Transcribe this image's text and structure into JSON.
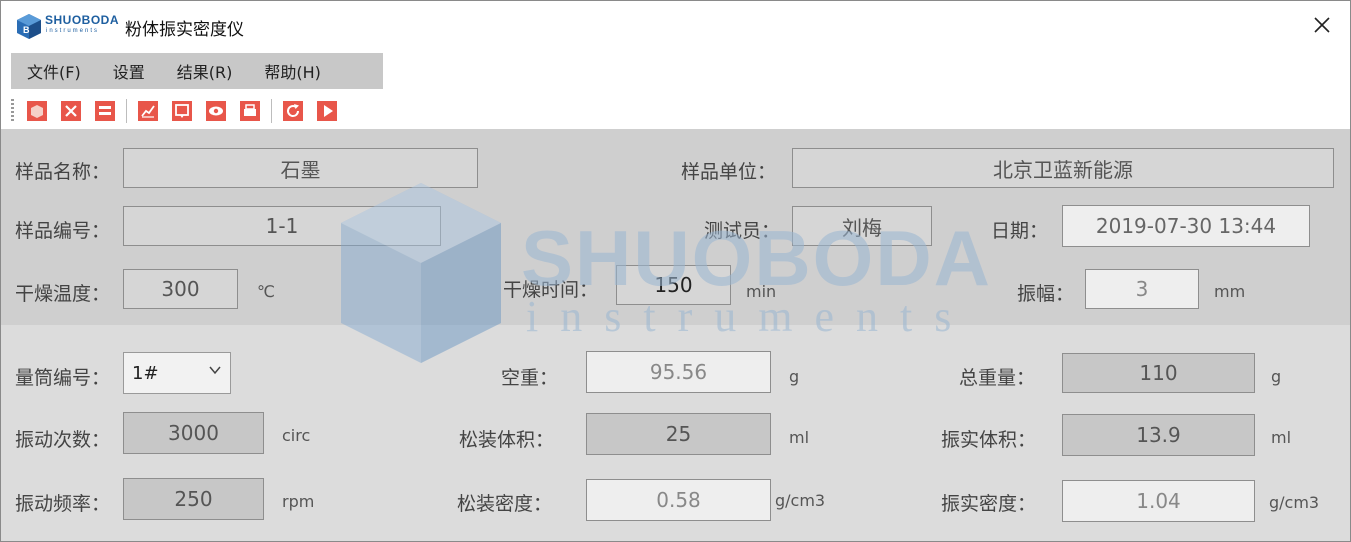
{
  "window": {
    "title": "粉体振实密度仪",
    "logo_text": "SHUOBODA",
    "logo_sub": "instruments"
  },
  "menu": [
    "文件(F)",
    "设置",
    "结果(R)",
    "帮助(H)"
  ],
  "toolbar_icons": [
    "new-icon",
    "close-file-icon",
    "layout-icon",
    "chart-icon",
    "report-icon",
    "view-icon",
    "print-icon",
    "refresh-icon",
    "start-icon"
  ],
  "colors": {
    "toolbar_icon": "#e8564a",
    "panel_top": "#cfcfcf",
    "panel_bottom": "#dcdcdc"
  },
  "watermark": {
    "main": "SHUOBODA",
    "sub": "instruments"
  },
  "sample": {
    "name_label": "样品名称：",
    "name_value": "石墨",
    "unit_label": "样品单位：",
    "unit_value": "北京卫蓝新能源",
    "id_label": "样品编号：",
    "id_value": "1-1",
    "tester_label": "测试员：",
    "tester_value": "刘梅",
    "date_label": "日期：",
    "date_value": "2019-07-30  13:44",
    "dry_temp_label": "干燥温度：",
    "dry_temp_value": "300",
    "dry_temp_unit": "℃",
    "dry_time_label": "干燥时间：",
    "dry_time_value": "150",
    "dry_time_unit": "min",
    "amplitude_label": "振幅：",
    "amplitude_value": "3",
    "amplitude_unit": "mm"
  },
  "measure": {
    "cylinder_label": "量筒编号：",
    "cylinder_value": "1#",
    "empty_weight_label": "空重：",
    "empty_weight_value": "95.56",
    "empty_weight_unit": "g",
    "total_weight_label": "总重量：",
    "total_weight_value": "110",
    "total_weight_unit": "g",
    "vib_count_label": "振动次数：",
    "vib_count_value": "3000",
    "vib_count_unit": "circ",
    "loose_vol_label": "松装体积：",
    "loose_vol_value": "25",
    "loose_vol_unit": "ml",
    "tap_vol_label": "振实体积：",
    "tap_vol_value": "13.9",
    "tap_vol_unit": "ml",
    "vib_freq_label": "振动频率：",
    "vib_freq_value": "250",
    "vib_freq_unit": "rpm",
    "loose_density_label": "松装密度：",
    "loose_density_value": "0.58",
    "loose_density_unit": "g/cm3",
    "tap_density_label": "振实密度：",
    "tap_density_value": "1.04",
    "tap_density_unit": "g/cm3"
  }
}
